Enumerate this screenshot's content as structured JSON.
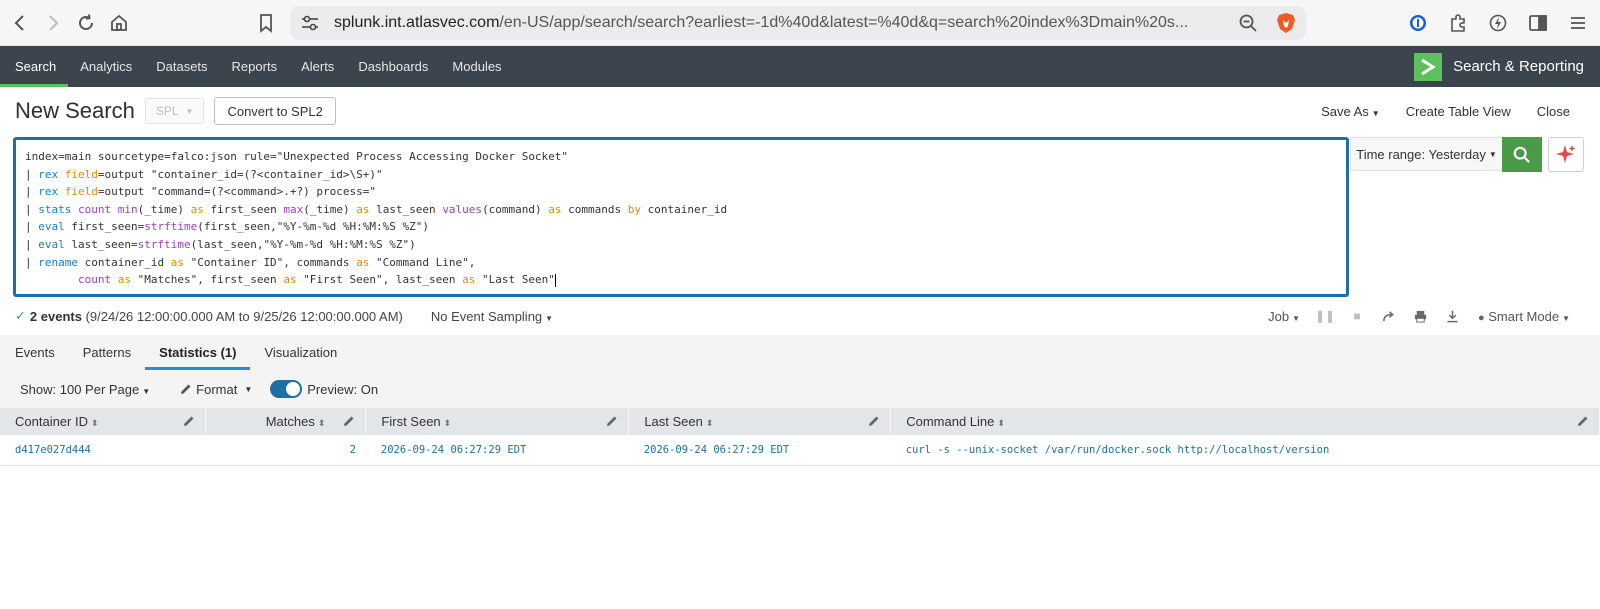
{
  "browser": {
    "url_host": "splunk.int.atlasvec.com",
    "url_path": "/en-US/app/search/search?earliest=-1d%40d&latest=%40d&q=search%20index%3Dmain%20s..."
  },
  "app_nav": {
    "items": [
      "Search",
      "Analytics",
      "Datasets",
      "Reports",
      "Alerts",
      "Dashboards",
      "Modules"
    ],
    "app_name": "Search & Reporting"
  },
  "header": {
    "title": "New Search",
    "language": "SPL",
    "convert_label": "Convert to SPL2",
    "save_as": "Save As",
    "create_table_view": "Create Table View",
    "close": "Close"
  },
  "search": {
    "time_range": "Time range: Yesterday",
    "query_lines": [
      "index=main sourcetype=falco:json rule=\"Unexpected Process Accessing Docker Socket\"",
      "| rex field=output \"container_id=(?<container_id>\\S+)\"",
      "| rex field=output \"command=(?<command>.+?) process=\"",
      "| stats count min(_time) as first_seen max(_time) as last_seen values(command) as commands by container_id",
      "| eval first_seen=strftime(first_seen,\"%Y-%m-%d %H:%M:%S %Z\")",
      "| eval last_seen=strftime(last_seen,\"%Y-%m-%d %H:%M:%S %Z\")",
      "| rename container_id as \"Container ID\", commands as \"Command Line\",",
      "        count as \"Matches\", first_seen as \"First Seen\", last_seen as \"Last Seen\""
    ]
  },
  "status": {
    "events": "2 events",
    "range": "(9/24/26 12:00:00.000 AM to 9/25/26 12:00:00.000 AM)",
    "sampling": "No Event Sampling",
    "job": "Job",
    "mode": "Smart Mode"
  },
  "tabs": [
    "Events",
    "Patterns",
    "Statistics (1)",
    "Visualization"
  ],
  "controls": {
    "per_page": "Show: 100 Per Page",
    "format": "Format",
    "preview": "Preview: On"
  },
  "table": {
    "columns": [
      "Container ID",
      "Matches",
      "First Seen",
      "Last Seen",
      "Command Line"
    ],
    "rows": [
      [
        "d417e027d444",
        "2",
        "2026-09-24 06:27:29 EDT",
        "2026-09-24 06:27:29 EDT",
        "curl -s --unix-socket /var/run/docker.sock http://localhost/version"
      ]
    ]
  },
  "colors": {
    "nav_bg": "#3c444d",
    "accent_green": "#5cc05c",
    "link_blue": "#1e6fa3"
  }
}
